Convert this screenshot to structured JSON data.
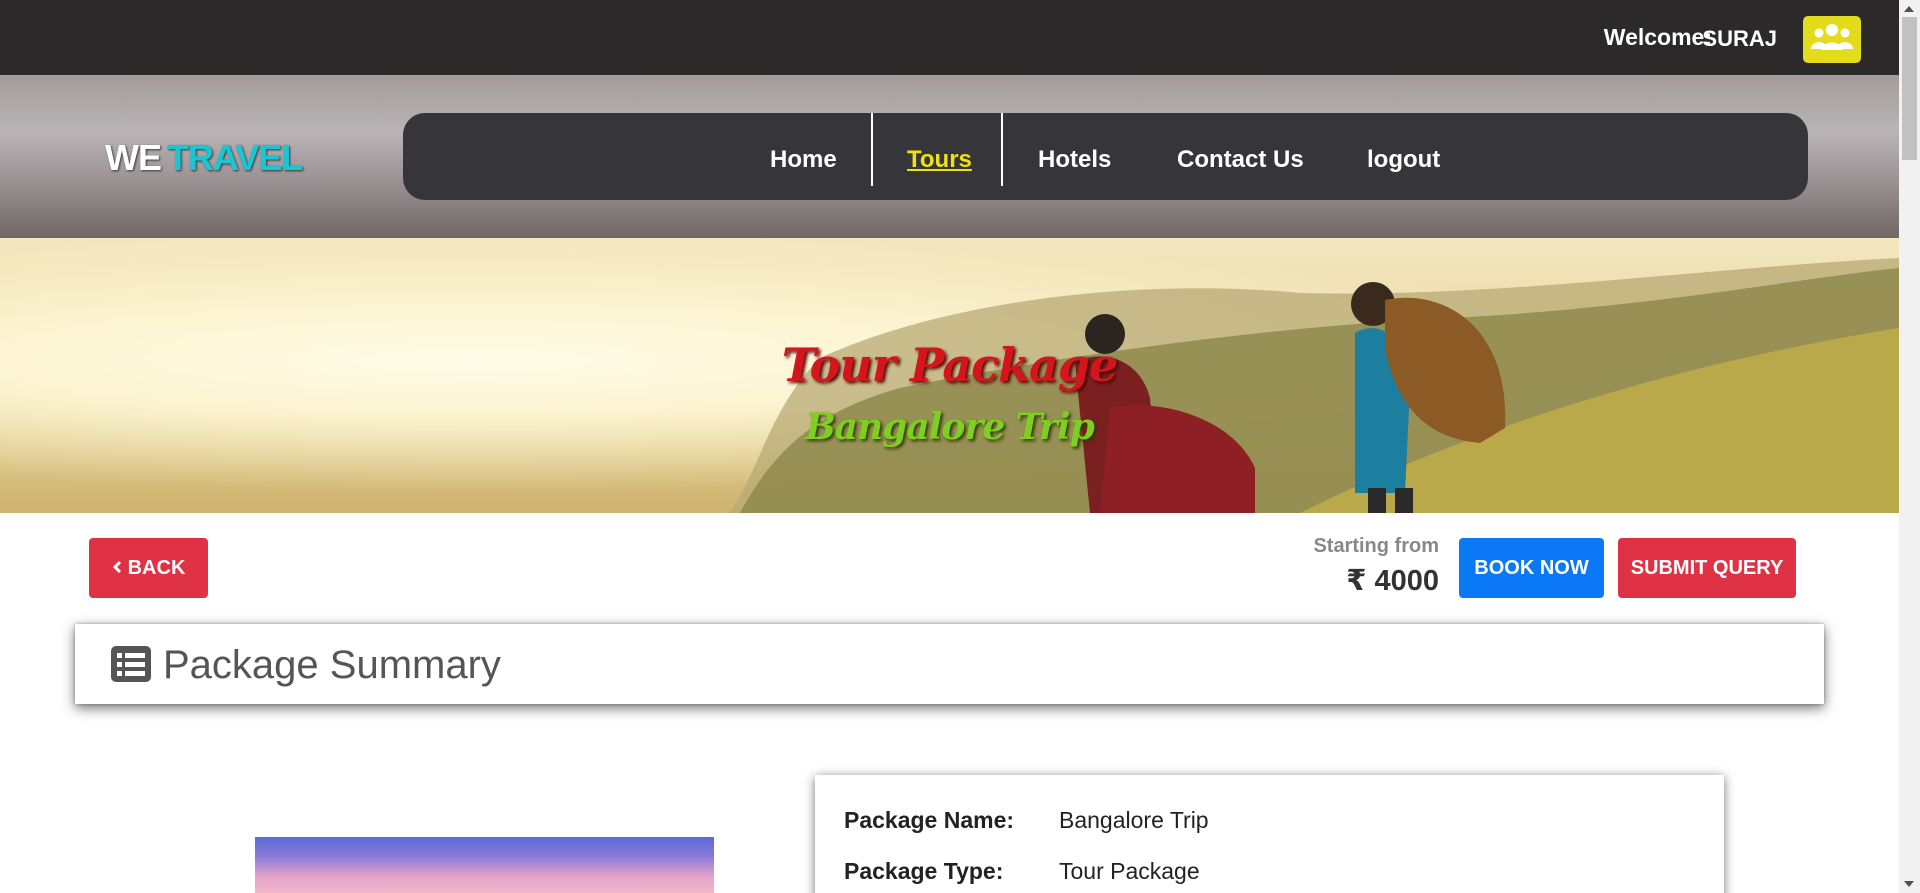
{
  "topbar": {
    "welcome_label": "Welcome:",
    "username": "SURAJ",
    "user_icon": "users-icon",
    "user_button_color": "#e2dc1c"
  },
  "header": {
    "logo_we": "WE",
    "logo_travel": "TRAVEL",
    "nav": [
      {
        "label": "Home",
        "active": false
      },
      {
        "label": "Tours",
        "active": true
      },
      {
        "label": "Hotels",
        "active": false
      },
      {
        "label": "Contact Us",
        "active": false
      },
      {
        "label": "logout",
        "active": false
      }
    ],
    "active_color": "#f0e113"
  },
  "hero": {
    "title": "Tour Package",
    "subtitle": "Bangalore Trip"
  },
  "actions": {
    "back_label": "BACK",
    "back_icon": "chevron-left-icon",
    "starting_from_label": "Starting from",
    "price": "₹ 4000",
    "book_label": "BOOK NOW",
    "query_label": "SUBMIT QUERY"
  },
  "summary": {
    "title": "Package Summary",
    "icon": "list-icon"
  },
  "details": [
    {
      "label": "Package Name:",
      "value": "Bangalore Trip"
    },
    {
      "label": "Package Type:",
      "value": "Tour Package"
    }
  ],
  "colors": {
    "danger": "#df3345",
    "primary": "#0b79f6",
    "logo_accent": "#19c6d6"
  }
}
